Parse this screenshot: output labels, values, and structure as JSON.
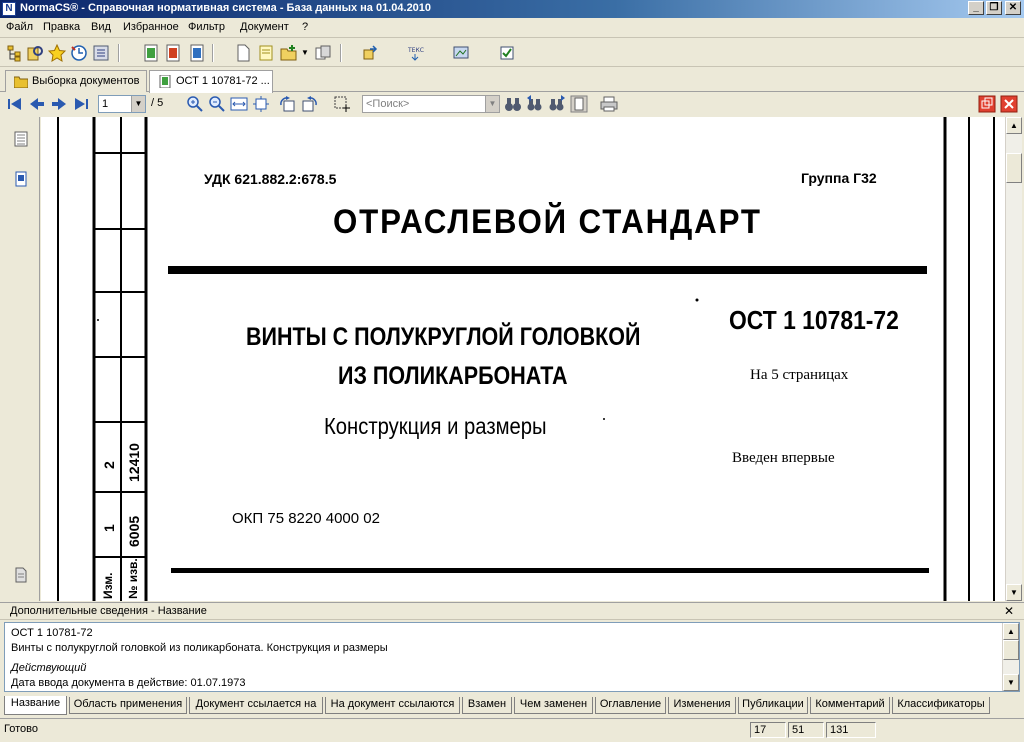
{
  "window": {
    "title": "NormaCS® - Справочная нормативная система - База данных на 01.04.2010",
    "icon": "N"
  },
  "menu": [
    "Файл",
    "Правка",
    "Вид",
    "Избранное",
    "Фильтр",
    "Документ",
    "?"
  ],
  "doc_tabs": [
    {
      "label": "Выборка документов",
      "active": false
    },
    {
      "label": "ОСТ 1 10781-72 ...",
      "active": true
    }
  ],
  "navigation": {
    "page_current": "1",
    "page_total": "/ 5",
    "search_placeholder": "<Поиск>"
  },
  "document": {
    "udk": "УДК 621.882.2:678.5",
    "group": "Группа Г32",
    "heading": "ОТРАСЛЕВОЙ СТАНДАРТ",
    "title_line1": "ВИНТЫ С ПОЛУКРУГЛОЙ ГОЛОВКОЙ",
    "title_line2": "ИЗ ПОЛИКАРБОНАТА",
    "subtitle": "Конструкция и размеры",
    "code": "ОСТ 1 10781-72",
    "pages": "На 5 страницах",
    "introduced": "Введен впервые",
    "okp": "ОКП 75 8220 4000 02",
    "margin_table": {
      "r1_num": "2",
      "r1_val": "12410",
      "r2_num": "1",
      "r2_val": "6005",
      "h1": "Изм.",
      "h2": "№ изв."
    }
  },
  "info_panel": {
    "header": "Дополнительные сведения - Название",
    "code": "ОСТ 1 10781-72",
    "name": "Винты с полукруглой головкой из поликарбоната. Конструкция и размеры",
    "status": "Действующий",
    "date": "Дата ввода документа в действие: 01.07.1973"
  },
  "bottom_tabs": [
    "Название",
    "Область применения",
    "Документ ссылается на",
    "На документ ссылаются",
    "Взамен",
    "Чем заменен",
    "Оглавление",
    "Изменения",
    "Публикации",
    "Комментарий",
    "Классификаторы"
  ],
  "status": {
    "text": "Готово",
    "c1": "17",
    "c2": "51",
    "c3": "131"
  },
  "colors": {
    "titlebar_start": "#0a246a",
    "face": "#ece9d8"
  }
}
